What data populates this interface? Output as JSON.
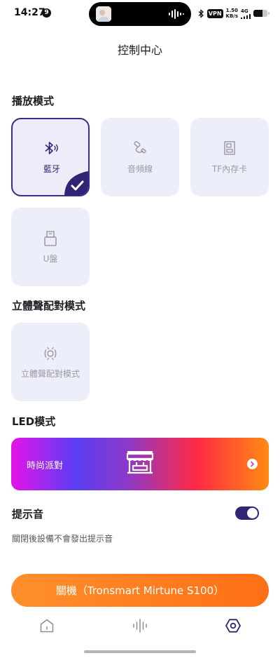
{
  "status_bar": {
    "time": "14:27",
    "notification_count": "9",
    "vpn": "VPN",
    "net_speed_value": "1.50",
    "net_speed_unit": "KB/s",
    "network": "4G",
    "battery_level": 0.65
  },
  "header": {
    "title": "控制中心"
  },
  "playback": {
    "title": "播放模式",
    "modes": [
      {
        "label": "藍牙",
        "icon": "bluetooth-icon",
        "selected": true
      },
      {
        "label": "音頻線",
        "icon": "audio-cable-icon",
        "selected": false
      },
      {
        "label": "TF內存卡",
        "icon": "sd-card-icon",
        "selected": false
      },
      {
        "label": "U盤",
        "icon": "usb-drive-icon",
        "selected": false
      }
    ]
  },
  "stereo": {
    "title": "立體聲配對模式",
    "tile_label": "立體聲配對模式",
    "icon": "stereo-pair-icon"
  },
  "led": {
    "title": "LED模式",
    "current": "時尚派對",
    "icon": "party-booth-icon"
  },
  "prompt_tone": {
    "title": "提示音",
    "enabled": true,
    "description": "關閉後設備不會發出提示音"
  },
  "power": {
    "label": "關機（Tronsmart Mirtune S100）"
  },
  "bottom_nav": [
    {
      "name": "home",
      "icon": "home-icon",
      "active": false
    },
    {
      "name": "equalizer",
      "icon": "sound-wave-icon",
      "active": false
    },
    {
      "name": "settings",
      "icon": "hexagon-settings-icon",
      "active": true
    }
  ],
  "colors": {
    "accent": "#2f2574",
    "tile_bg": "#eceef9",
    "power_button": "#ff7a1f",
    "icon_inactive": "#9b9ba6"
  }
}
